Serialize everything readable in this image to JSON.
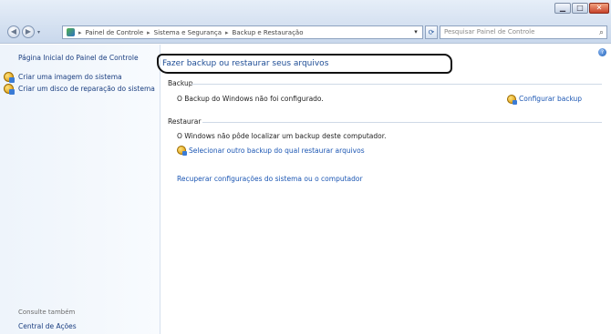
{
  "window": {
    "minimize_glyph": "▁",
    "maximize_glyph": "□",
    "close_glyph": "✕"
  },
  "address_bar": {
    "crumbs": [
      "Painel de Controle",
      "Sistema e Segurança",
      "Backup e Restauração"
    ],
    "separator": "▸"
  },
  "search": {
    "placeholder": "Pesquisar Painel de Controle"
  },
  "sidebar": {
    "home_link": "Página Inicial do Painel de Controle",
    "items": [
      {
        "label": "Criar uma imagem do sistema",
        "icon": "shield-icon"
      },
      {
        "label": "Criar um disco de reparação do sistema",
        "icon": "shield-icon"
      }
    ],
    "see_also": "Consulte também",
    "bottom_link": "Central de Ações"
  },
  "main": {
    "headline": "Fazer backup ou restaurar seus arquivos",
    "backup_section": "Backup",
    "backup_status": "O Backup do Windows não foi configurado.",
    "configure_backup": "Configurar backup",
    "restore_section": "Restaurar",
    "restore_status": "O Windows não pôde localizar um backup deste computador.",
    "select_other_backup": "Selecionar outro backup do qual restaurar arquivos",
    "recover_link": "Recuperar configurações do sistema ou o computador"
  },
  "colors": {
    "link": "#1b56b3",
    "headline": "#1d4c95",
    "sidebar_bg": "#eef4fb",
    "chrome_bg": "#c9d8ec"
  }
}
